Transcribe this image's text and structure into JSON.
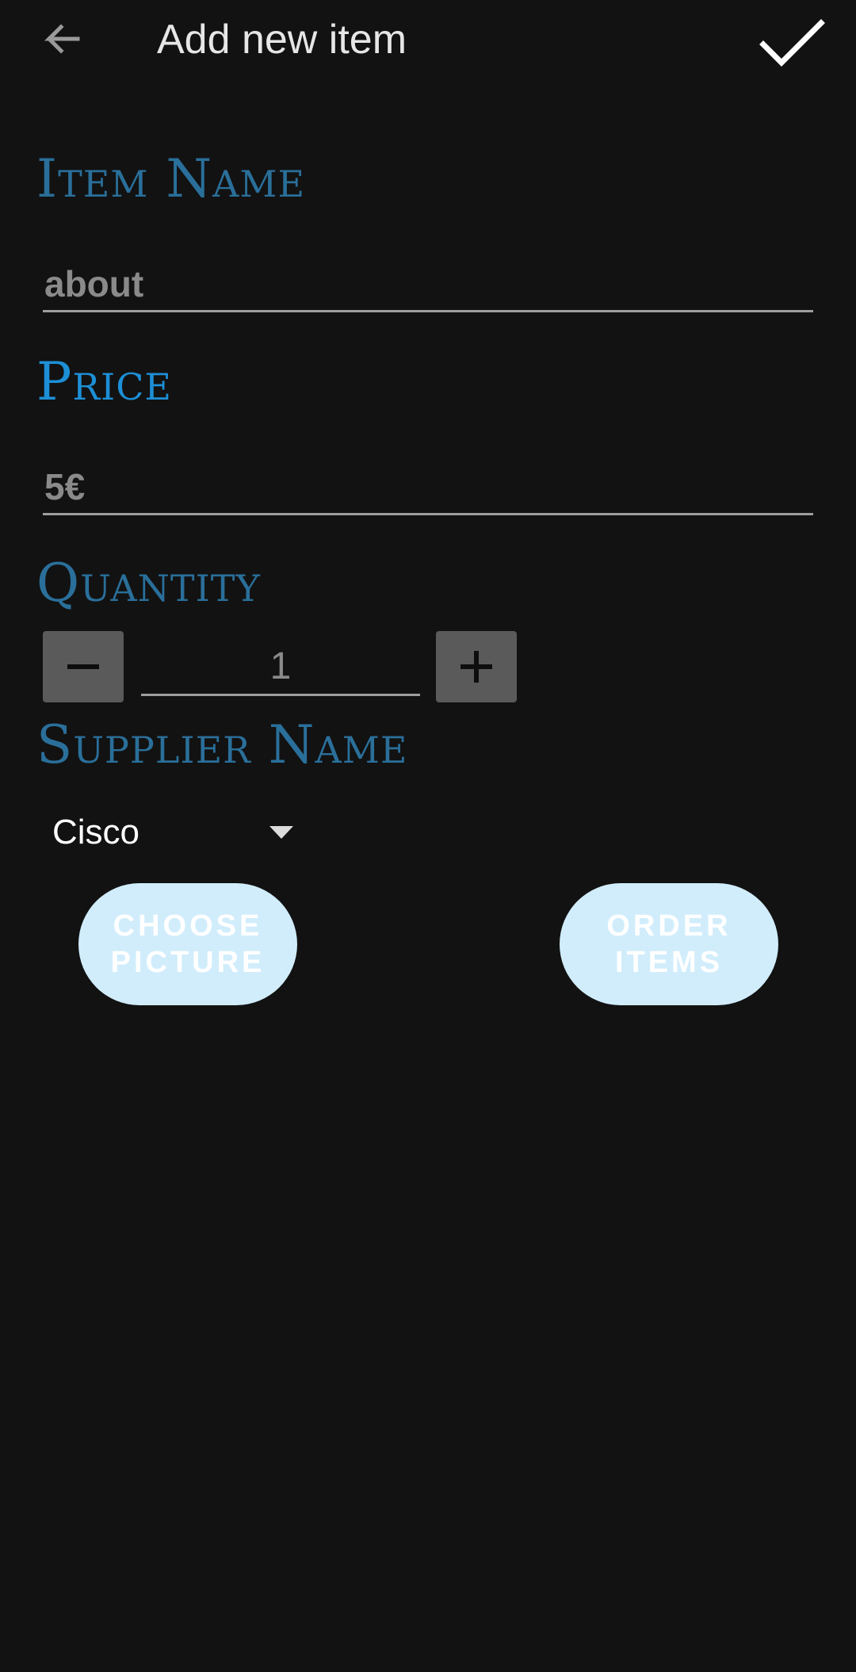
{
  "appbar": {
    "title": "Add new item",
    "back_icon": "arrow-back-icon",
    "confirm_icon": "check-icon"
  },
  "item_name": {
    "label": "Item Name",
    "value": "about"
  },
  "price": {
    "label": "Price",
    "value": "5€"
  },
  "quantity": {
    "label": "Quantity",
    "value": "1",
    "decrement_icon": "minus-icon",
    "increment_icon": "plus-icon"
  },
  "supplier": {
    "label": "Supplier Name",
    "selected": "Cisco"
  },
  "buttons": {
    "choose_picture": "CHOOSE PICTURE",
    "order_items": "ORDER ITEMS"
  },
  "colors": {
    "background": "#121212",
    "label": "#2a6f9a",
    "label_active": "#1d8fd6",
    "button_fill": "#d1edfc",
    "stepper_fill": "#5a5a5a"
  }
}
